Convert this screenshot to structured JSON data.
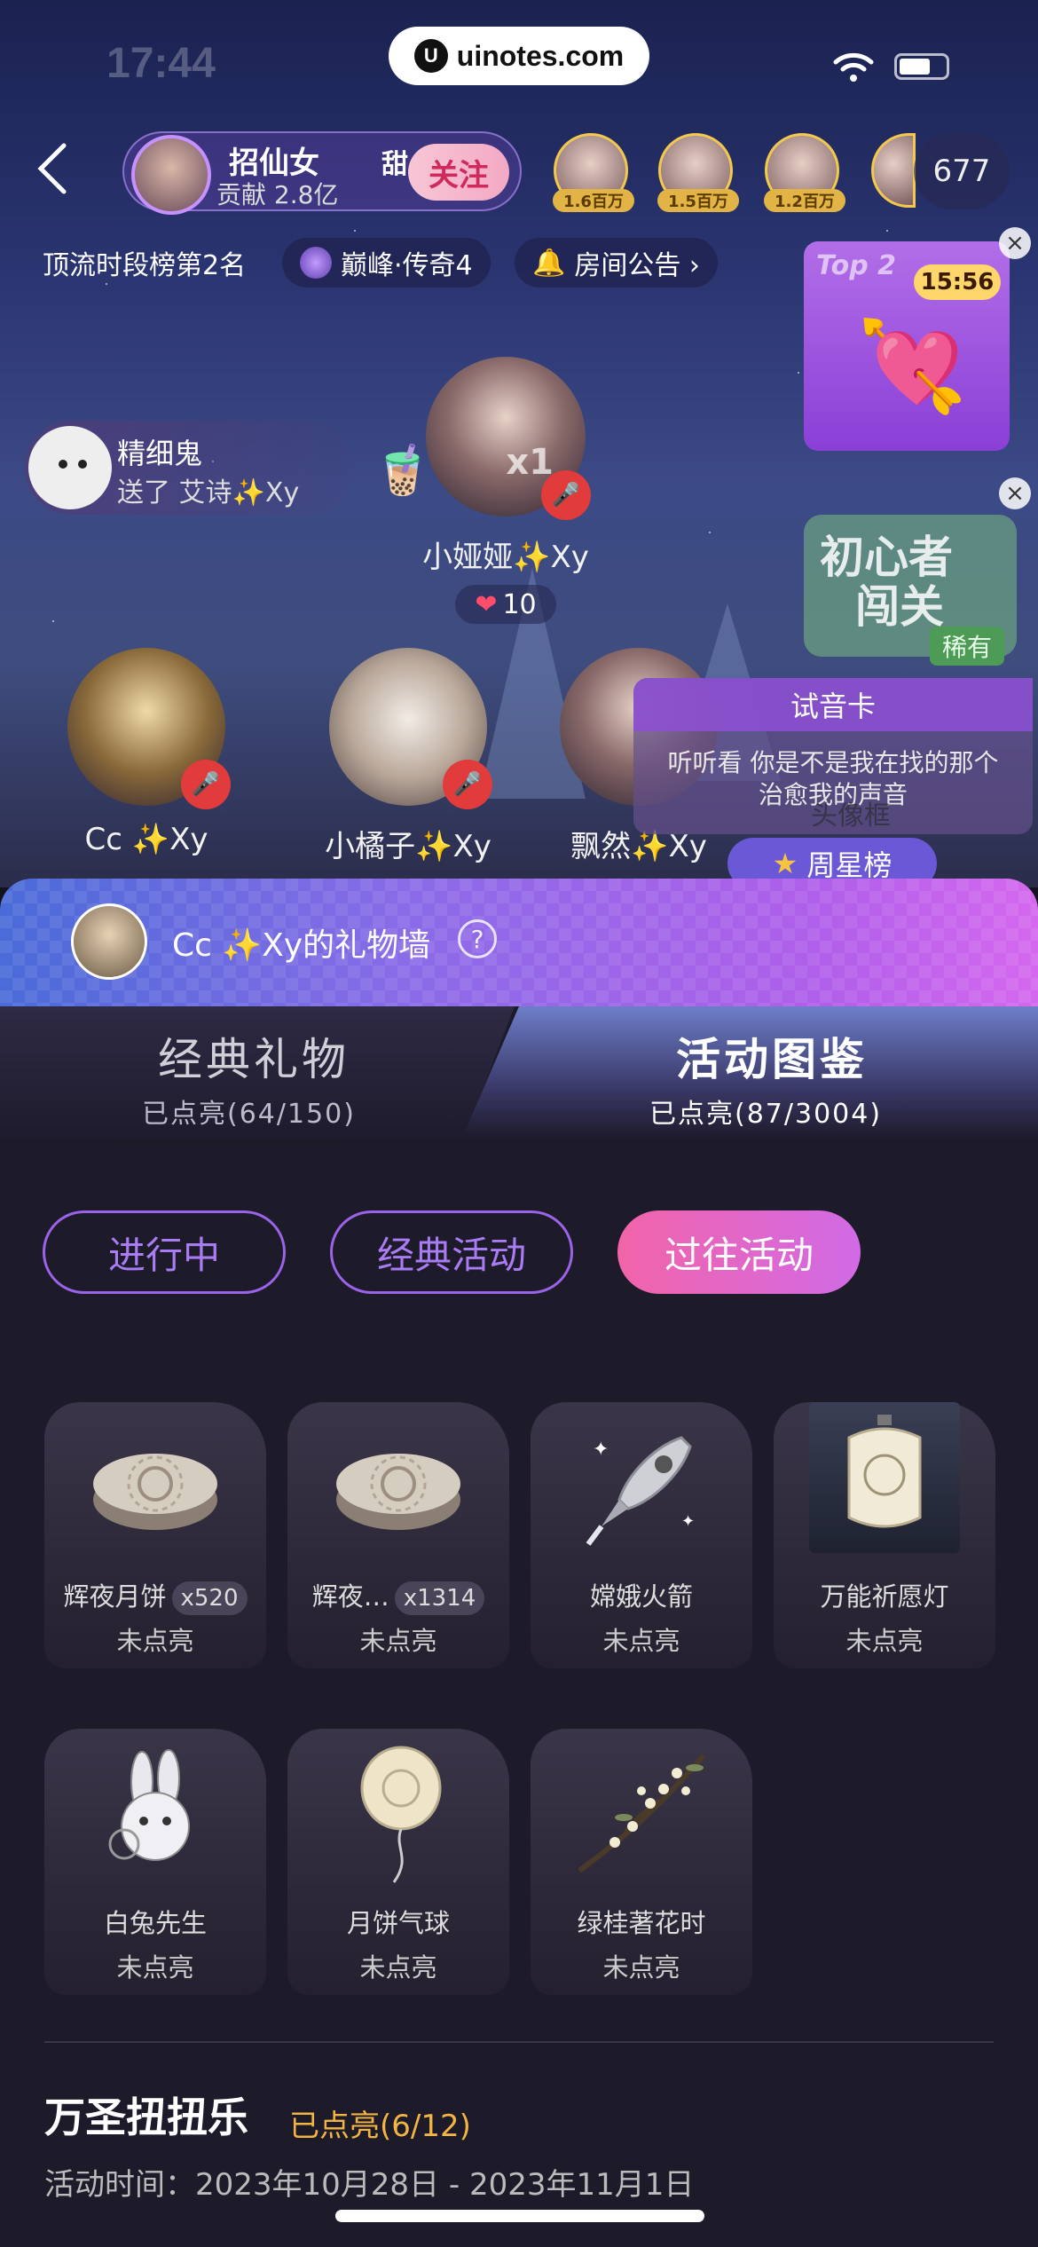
{
  "status_bar": {
    "time": "17:44",
    "url": "uinotes.com",
    "url_logo": "U"
  },
  "room": {
    "host": {
      "name": "招仙女",
      "sweet": "甜",
      "contribution": "贡献 2.8亿",
      "follow_label": "关注"
    },
    "top_fans": [
      {
        "label": "1.6百万"
      },
      {
        "label": "1.5百万"
      },
      {
        "label": "1.2百万"
      }
    ],
    "viewer_count": "677",
    "chips": {
      "rank": "顶流时段榜第2名",
      "level": "巅峰·传奇4",
      "notice": "房间公告 ›"
    },
    "gift_feed": {
      "name": "精细鬼",
      "text": "送了 艾诗✨Xy"
    },
    "seats": [
      {
        "name": "小娅娅✨Xy",
        "hearts": "10"
      },
      {
        "name": "Cc ✨Xy"
      },
      {
        "name": "小橘子✨Xy"
      },
      {
        "name": "飘然✨Xy"
      }
    ],
    "gift_multiplier": "x1",
    "badge": {
      "top": "Top 2",
      "timer": "15:56"
    },
    "newbie": {
      "line1": "初心者",
      "line2": "闯关",
      "rare": "稀有"
    },
    "voice_card": {
      "title": "试音卡",
      "text": "听听看 你是不是我在找的那个治愈我的声音",
      "frame": "头像框"
    },
    "week_rank_label": "周星榜"
  },
  "gift_wall": {
    "title": "Cc ✨Xy的礼物墙",
    "help": "?",
    "tabs": [
      {
        "label": "经典礼物",
        "sub": "已点亮(64/150)"
      },
      {
        "label": "活动图鉴",
        "sub": "已点亮(87/3004)"
      }
    ],
    "filters": [
      "进行中",
      "经典活动",
      "过往活动"
    ],
    "items": [
      {
        "name": "辉夜月饼",
        "count": "x520",
        "status": "未点亮",
        "icon": "mooncake-icon"
      },
      {
        "name": "辉夜…",
        "count": "x1314",
        "status": "未点亮",
        "icon": "mooncake-icon"
      },
      {
        "name": "嫦娥火箭",
        "count": "",
        "status": "未点亮",
        "icon": "rocket-icon"
      },
      {
        "name": "万能祈愿灯",
        "count": "",
        "status": "未点亮",
        "icon": "lantern-icon"
      },
      {
        "name": "白兔先生",
        "count": "",
        "status": "未点亮",
        "icon": "rabbit-icon"
      },
      {
        "name": "月饼气球",
        "count": "",
        "status": "未点亮",
        "icon": "balloon-icon"
      },
      {
        "name": "绿桂著花时",
        "count": "",
        "status": "未点亮",
        "icon": "osmanthus-icon"
      }
    ],
    "event": {
      "title": "万圣扭扭乐",
      "lit": "已点亮(6/12)",
      "time": "活动时间：2023年10月28日 - 2023年11月1日"
    }
  },
  "colors": {
    "accent": "#d16ae6",
    "filter_outline": "#9a63e8",
    "lit_color": "#f2b542"
  }
}
